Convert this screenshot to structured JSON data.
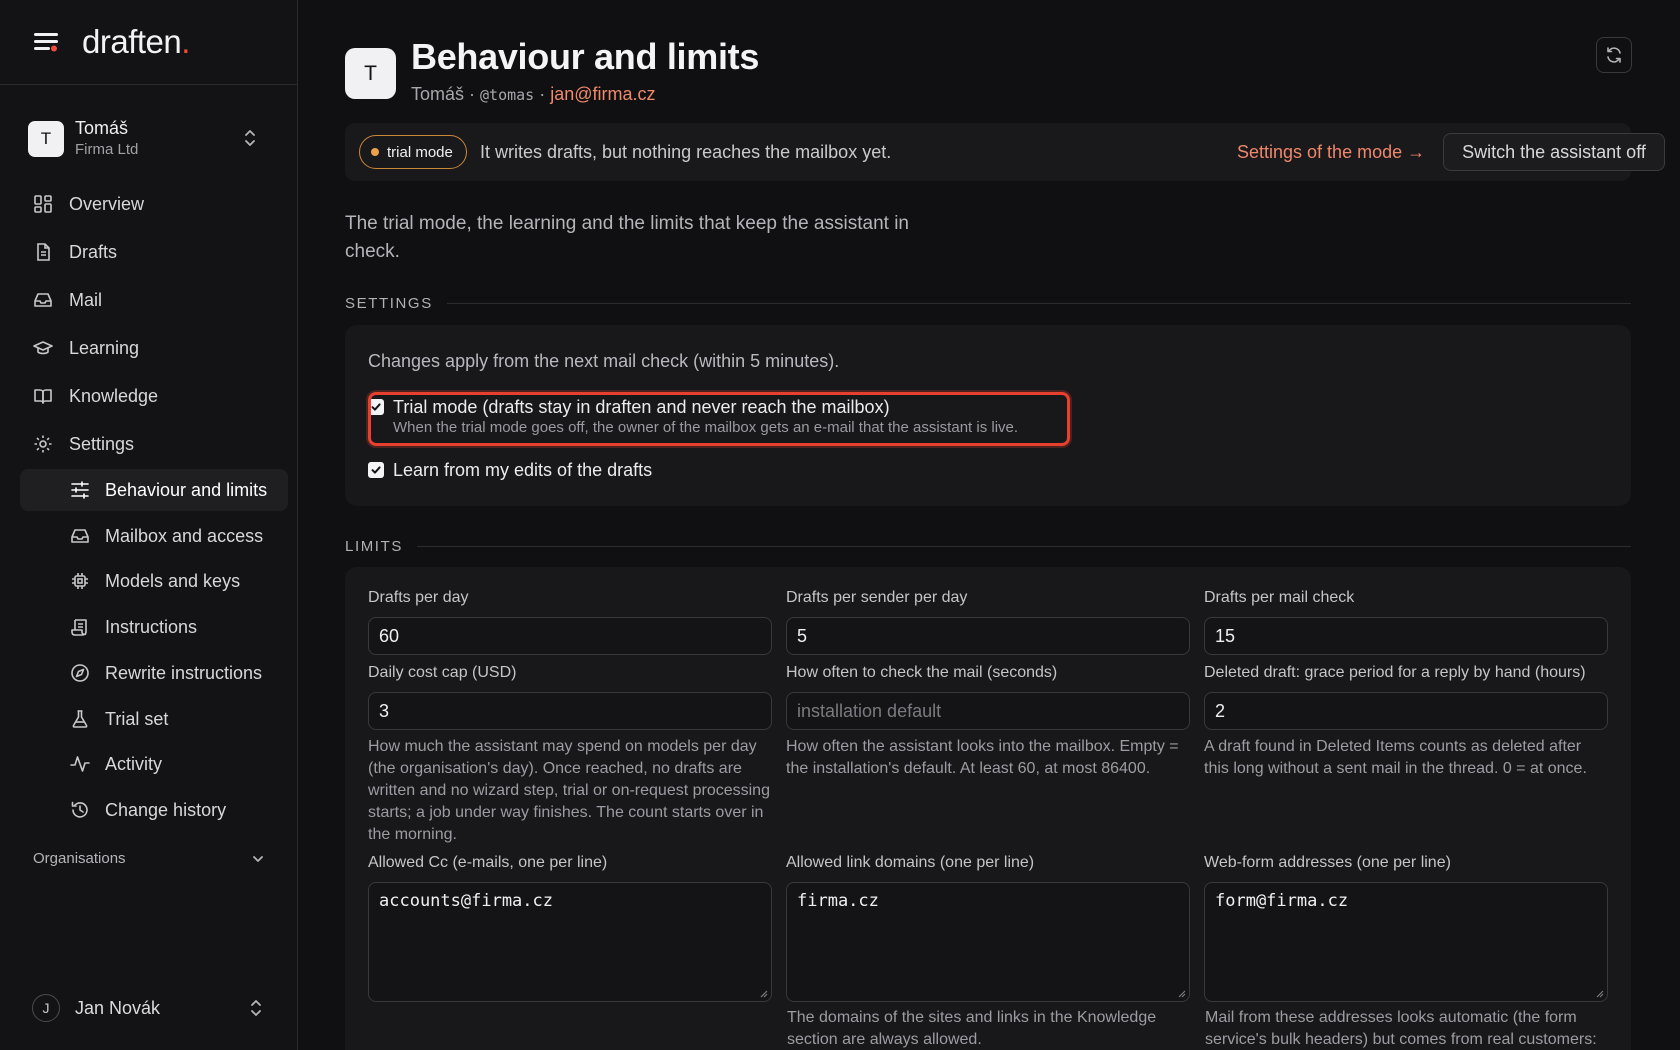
{
  "brand": {
    "name": "draften",
    "dot": "."
  },
  "tenant": {
    "initial": "T",
    "name": "Tomáš",
    "org": "Firma Ltd"
  },
  "nav": {
    "items": [
      {
        "label": "Overview"
      },
      {
        "label": "Drafts"
      },
      {
        "label": "Mail"
      },
      {
        "label": "Learning"
      },
      {
        "label": "Knowledge"
      },
      {
        "label": "Settings"
      }
    ],
    "sub_items": [
      {
        "label": "Behaviour and limits"
      },
      {
        "label": "Mailbox and access"
      },
      {
        "label": "Models and keys"
      },
      {
        "label": "Instructions"
      },
      {
        "label": "Rewrite instructions"
      },
      {
        "label": "Trial set"
      },
      {
        "label": "Activity"
      },
      {
        "label": "Change history"
      }
    ],
    "organisations_label": "Organisations"
  },
  "user": {
    "initial": "J",
    "name": "Jan Novák"
  },
  "page": {
    "initial": "T",
    "title": "Behaviour and limits",
    "sub_name": "Tomáš",
    "sep": " · ",
    "sub_handle": "@tomas",
    "sub_email": "jan@firma.cz"
  },
  "trial_bar": {
    "pill": "trial mode",
    "message": "It writes drafts, but nothing reaches the mailbox yet.",
    "link": "Settings of the mode →",
    "button": "Switch the assistant off"
  },
  "intro": "The trial mode, the learning and the limits that keep the assistant in check.",
  "settings": {
    "heading": "SETTINGS",
    "note": "Changes apply from the next mail check (within 5 minutes).",
    "trial_mode": {
      "label": "Trial mode (drafts stay in draften and never reach the mailbox)",
      "hint": "When the trial mode goes off, the owner of the mailbox gets an e-mail that the assistant is live.",
      "checked": true
    },
    "learn": {
      "label": "Learn from my edits of the drafts",
      "checked": true
    }
  },
  "limits": {
    "heading": "LIMITS",
    "drafts_per_day": {
      "label": "Drafts per day",
      "value": "60"
    },
    "drafts_per_sender": {
      "label": "Drafts per sender per day",
      "value": "5"
    },
    "drafts_per_check": {
      "label": "Drafts per mail check",
      "value": "15"
    },
    "daily_cost": {
      "label": "Daily cost cap (USD)",
      "value": "3",
      "help": "How much the assistant may spend on models per day (the organisation's day). Once reached, no drafts are written and no wizard step, trial or on-request processing starts; a job under way finishes. The count starts over in the morning."
    },
    "check_interval": {
      "label": "How often to check the mail (seconds)",
      "placeholder": "installation default",
      "help": "How often the assistant looks into the mailbox. Empty = the installation's default. At least 60, at most 86400."
    },
    "grace_period": {
      "label": "Deleted draft: grace period for a reply by hand (hours)",
      "value": "2",
      "help": "A draft found in Deleted Items counts as deleted after this long without a sent mail in the thread. 0 = at once."
    },
    "allowed_cc": {
      "label": "Allowed Cc (e-mails, one per line)",
      "value": "accounts@firma.cz"
    },
    "link_domains": {
      "label": "Allowed link domains (one per line)",
      "value": "firma.cz",
      "help": "The domains of the sites and links in the Knowledge section are always allowed."
    },
    "webform": {
      "label": "Web-form addresses (one per line)",
      "value": "form@firma.cz",
      "help": "Mail from these addresses looks automatic (the form service's bulk headers) but comes from real customers:"
    }
  },
  "colors": {
    "accent": "#ef8a6a",
    "brand_dot": "#ef4a3c",
    "trial": "#eaa14a",
    "highlight": "#e8402f"
  }
}
